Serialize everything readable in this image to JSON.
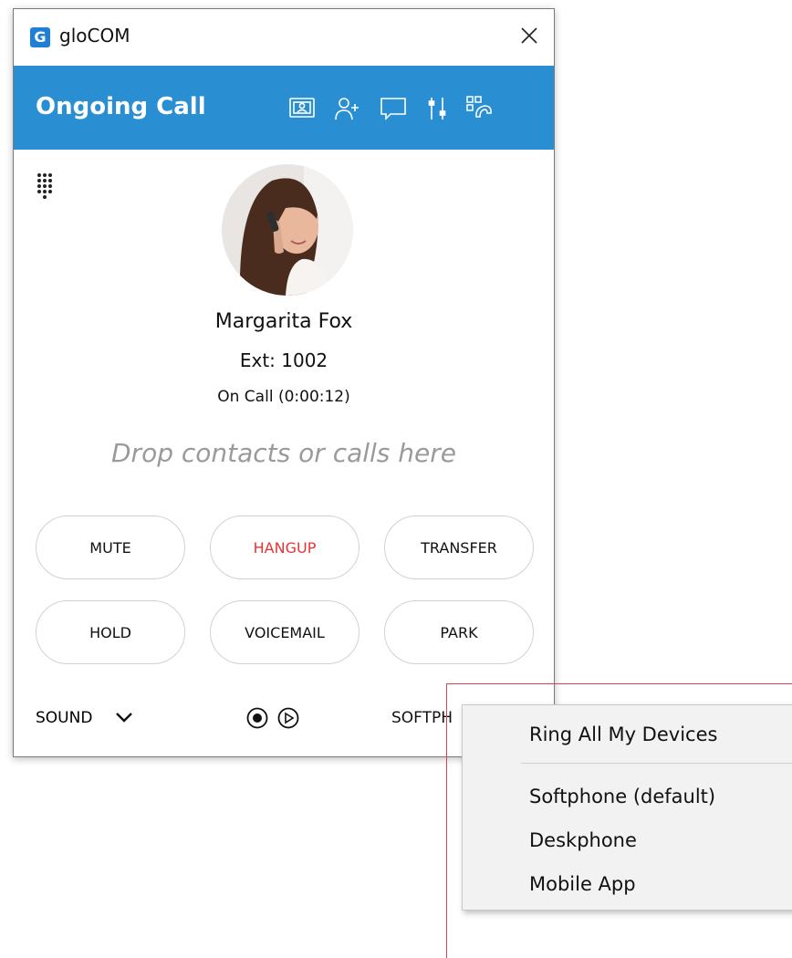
{
  "window": {
    "title": "gloCOM",
    "close_icon": "close-icon"
  },
  "header": {
    "title": "Ongoing Call",
    "icons": [
      "screen-share-icon",
      "add-contact-icon",
      "chat-icon",
      "settings-sliders-icon",
      "call-pickup-icon"
    ],
    "color": "#2a8fd2"
  },
  "contact": {
    "name": "Margarita Fox",
    "ext": "Ext: 1002",
    "status": "On Call (0:00:12)"
  },
  "drop_zone": "Drop contacts or calls here",
  "buttons": {
    "mute": "MUTE",
    "hangup": "HANGUP",
    "transfer": "TRANSFER",
    "hold": "HOLD",
    "voicemail": "VOICEMAIL",
    "park": "PARK"
  },
  "footer": {
    "sound": "SOUND",
    "device": "SOFTPH"
  },
  "menu": {
    "ring_all": "Ring All My Devices",
    "softphone": "Softphone (default)",
    "deskphone": "Deskphone",
    "mobile": "Mobile App"
  },
  "colors": {
    "accent": "#2a8fd2",
    "hangup": "#e63434",
    "highlight": "#d94050"
  }
}
